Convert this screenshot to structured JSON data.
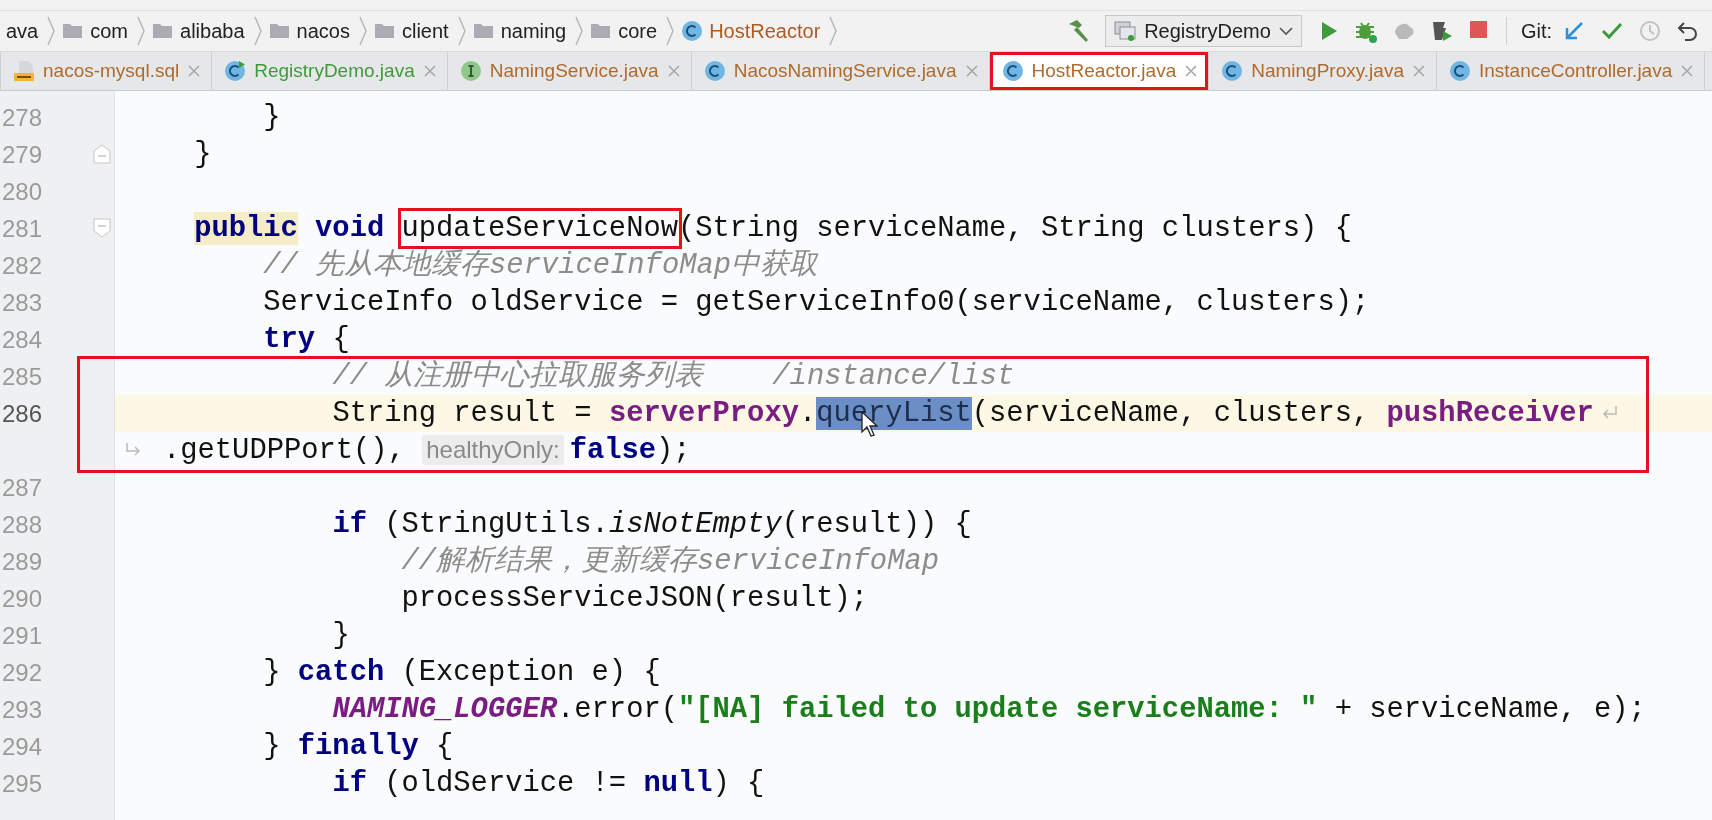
{
  "breadcrumb": [
    {
      "label": "ava",
      "kind": "text"
    },
    {
      "label": "com",
      "kind": "folder"
    },
    {
      "label": "alibaba",
      "kind": "folder"
    },
    {
      "label": "nacos",
      "kind": "folder"
    },
    {
      "label": "client",
      "kind": "folder"
    },
    {
      "label": "naming",
      "kind": "folder"
    },
    {
      "label": "core",
      "kind": "folder"
    },
    {
      "label": "HostReactor",
      "kind": "class"
    }
  ],
  "toolbar": {
    "run_config": "RegistryDemo",
    "git_label": "Git:"
  },
  "tabs": [
    {
      "label": "nacos-mysql.sql",
      "kind": "sql",
      "color": "#b06a2c",
      "selected": false,
      "boxed": false
    },
    {
      "label": "RegistryDemo.java",
      "kind": "class_run",
      "color": "#3f9a3a",
      "selected": false,
      "boxed": false
    },
    {
      "label": "NamingService.java",
      "kind": "interface",
      "color": "#b06a2c",
      "selected": false,
      "boxed": false
    },
    {
      "label": "NacosNamingService.java",
      "kind": "class",
      "color": "#b06a2c",
      "selected": false,
      "boxed": false
    },
    {
      "label": "HostReactor.java",
      "kind": "class",
      "color": "#b06a2c",
      "selected": true,
      "boxed": true
    },
    {
      "label": "NamingProxy.java",
      "kind": "class",
      "color": "#b06a2c",
      "selected": false,
      "boxed": false
    },
    {
      "label": "InstanceController.java",
      "kind": "class",
      "color": "#b06a2c",
      "selected": false,
      "boxed": false
    }
  ],
  "editor": {
    "lines": [
      {
        "kind": "line",
        "number": "278",
        "current": false,
        "tokens": [
          {
            "text": "        }",
            "kind": "plain"
          }
        ]
      },
      {
        "kind": "line",
        "number": "279",
        "current": false,
        "fold_marker": {
          "kind": "end"
        },
        "tokens": [
          {
            "text": "    }",
            "kind": "plain"
          }
        ]
      },
      {
        "kind": "line",
        "number": "280",
        "current": false
      },
      {
        "kind": "line",
        "number": "281",
        "current": false,
        "fold_marker": {
          "kind": "start"
        },
        "tokens": [
          {
            "text": "    public",
            "kind": "keyword_hl"
          },
          {
            "text": " void",
            "kind": "keyword"
          },
          {
            "text": " updateServiceNow",
            "kind": "plain",
            "boxed": true
          },
          {
            "text": "(String serviceName, String clusters) {",
            "kind": "plain"
          }
        ]
      },
      {
        "kind": "line",
        "number": "282",
        "current": false,
        "tokens": [
          {
            "text": "        // 先从本地缓存serviceInfoMap中获取",
            "kind": "comment"
          }
        ]
      },
      {
        "kind": "line",
        "number": "283",
        "current": false,
        "tokens": [
          {
            "text": "        ServiceInfo oldService = getServiceInfo0(serviceName, clusters);",
            "kind": "plain"
          }
        ]
      },
      {
        "kind": "line",
        "number": "284",
        "current": false,
        "tokens": [
          {
            "text": "        try",
            "kind": "keyword"
          },
          {
            "text": " {",
            "kind": "plain"
          }
        ]
      },
      {
        "kind": "annotation_group",
        "lines": [
          {
            "kind": "line",
            "number": "285",
            "current": false,
            "tokens": [
              {
                "text": "            // 从注册中心拉取服务列表    /instance/list",
                "kind": "comment"
              }
            ]
          },
          {
            "kind": "line",
            "number": "286",
            "current": true,
            "tokens": [
              {
                "text": "            String result = ",
                "kind": "plain"
              },
              {
                "text": "serverProxy",
                "kind": "field"
              },
              {
                "text": ".",
                "kind": "plain"
              },
              {
                "text": "queryList",
                "kind": "selected"
              },
              {
                "text": "(serviceName, clusters, ",
                "kind": "plain"
              },
              {
                "text": "pushReceiver",
                "kind": "field"
              }
            ],
            "continuation": [
              {
                "text": ".getUDPPort(), ",
                "kind": "plain"
              },
              {
                "text": "healthyOnly:",
                "kind": "hint"
              },
              {
                "text": "false",
                "kind": "keyword"
              },
              {
                "text": ");",
                "kind": "plain"
              }
            ]
          }
        ]
      },
      {
        "kind": "line",
        "number": "287",
        "current": false
      },
      {
        "kind": "line",
        "number": "288",
        "current": false,
        "tokens": [
          {
            "text": "            if",
            "kind": "keyword"
          },
          {
            "text": " (StringUtils.",
            "kind": "plain"
          },
          {
            "text": "isNotEmpty",
            "kind": "italic"
          },
          {
            "text": "(result)) {",
            "kind": "plain"
          }
        ]
      },
      {
        "kind": "line",
        "number": "289",
        "current": false,
        "tokens": [
          {
            "text": "                //解析结果，更新缓存serviceInfoMap",
            "kind": "comment"
          }
        ]
      },
      {
        "kind": "line",
        "number": "290",
        "current": false,
        "tokens": [
          {
            "text": "                processServiceJSON(result);",
            "kind": "plain"
          }
        ]
      },
      {
        "kind": "line",
        "number": "291",
        "current": false,
        "tokens": [
          {
            "text": "            }",
            "kind": "plain"
          }
        ]
      },
      {
        "kind": "line",
        "number": "292",
        "current": false,
        "tokens": [
          {
            "text": "        } ",
            "kind": "plain"
          },
          {
            "text": "catch",
            "kind": "keyword"
          },
          {
            "text": " (Exception e) {",
            "kind": "plain"
          }
        ]
      },
      {
        "kind": "line",
        "number": "293",
        "current": false,
        "tokens": [
          {
            "text": "            NAMING_LOGGER",
            "kind": "static"
          },
          {
            "text": ".error(",
            "kind": "plain"
          },
          {
            "text": "\"[NA] failed to update serviceName: \"",
            "kind": "string"
          },
          {
            "text": " + serviceName, e);",
            "kind": "plain"
          }
        ]
      },
      {
        "kind": "line",
        "number": "294",
        "current": false,
        "tokens": [
          {
            "text": "        } ",
            "kind": "plain"
          },
          {
            "text": "finally",
            "kind": "keyword"
          },
          {
            "text": " {",
            "kind": "plain"
          }
        ]
      },
      {
        "kind": "line",
        "number": "295",
        "current": false,
        "tokens": [
          {
            "text": "            if",
            "kind": "keyword"
          },
          {
            "text": " (oldService != ",
            "kind": "plain"
          },
          {
            "text": "null",
            "kind": "keyword"
          },
          {
            "text": ") {",
            "kind": "plain"
          }
        ]
      }
    ]
  }
}
